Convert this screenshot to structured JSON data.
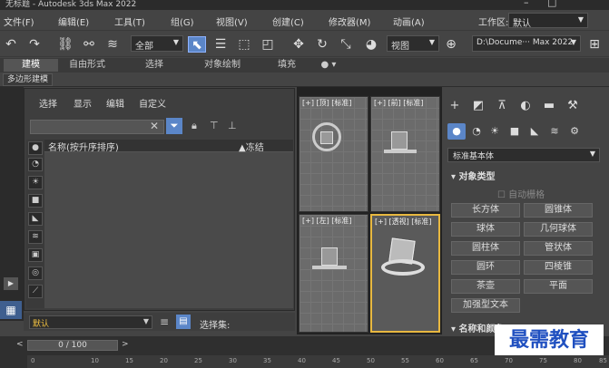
{
  "window": {
    "title": "无标题 - Autodesk 3ds Max 2022",
    "minimize": "–",
    "maximize": "□"
  },
  "menu": [
    "文件(F)",
    "编辑(E)",
    "工具(T)",
    "组(G)",
    "视图(V)",
    "创建(C)",
    "修改器(M)",
    "动画(A)"
  ],
  "workspace": {
    "label": "工作区:",
    "value": "默认"
  },
  "toolbar": {
    "filter": "全部",
    "view": "视图",
    "path": "D:\\Docume··· Max 2022"
  },
  "ribbon_tabs": [
    "建模",
    "自由形式",
    "选择",
    "对象绘制",
    "填充"
  ],
  "ribbon_sub": "多边形建模",
  "scene_explorer": {
    "menu": [
      "选择",
      "显示",
      "编辑",
      "自定义"
    ],
    "col_name": "名称(按升序排序)",
    "col_frozen": "▲冻结",
    "layer": "默认",
    "selection_set": "选择集:"
  },
  "viewports": [
    {
      "label": "[+] [顶] [标准]"
    },
    {
      "label": "[+] [前] [标准]"
    },
    {
      "label": "[+] [左] [标准]"
    },
    {
      "label": "[+] [透视] [标准]"
    }
  ],
  "command_panel": {
    "category": "标准基本体",
    "section_object_type": "▾ 对象类型",
    "autogrid": "自动栅格",
    "buttons": [
      "长方体",
      "圆锥体",
      "球体",
      "几何球体",
      "圆柱体",
      "管状体",
      "圆环",
      "四棱锥",
      "茶壶",
      "平面",
      "加强型文本"
    ],
    "section_name_color": "▾ 名称和颜色"
  },
  "timeline": {
    "frame": "0 / 100",
    "ticks": [
      "0",
      "10",
      "15",
      "20",
      "25",
      "30",
      "35",
      "40",
      "45",
      "50",
      "55",
      "60",
      "65",
      "70",
      "75",
      "80",
      "85"
    ]
  },
  "watermark": "最需教育"
}
